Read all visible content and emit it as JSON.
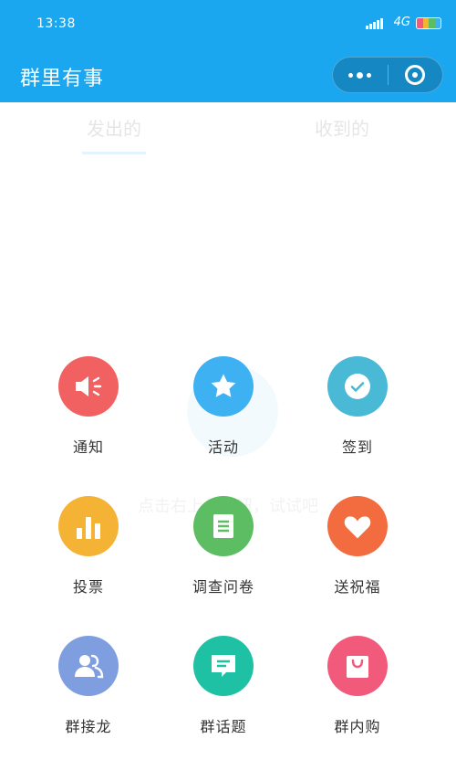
{
  "status_bar": {
    "time": "13:38",
    "network": "4G"
  },
  "header": {
    "title": "群里有事"
  },
  "tabs": [
    {
      "label": "发出的"
    },
    {
      "label": "收到的"
    }
  ],
  "hint": "点击右上角按钮，试试吧",
  "menu": [
    {
      "label": "通知",
      "icon": "megaphone-icon",
      "color": "#f26161"
    },
    {
      "label": "活动",
      "icon": "star-icon",
      "color": "#3db1f1"
    },
    {
      "label": "签到",
      "icon": "check-icon",
      "color": "#49b9d6"
    },
    {
      "label": "投票",
      "icon": "bar-chart-icon",
      "color": "#f5b335"
    },
    {
      "label": "调查问卷",
      "icon": "document-icon",
      "color": "#5cbd62"
    },
    {
      "label": "送祝福",
      "icon": "heart-icon",
      "color": "#f36c3f"
    },
    {
      "label": "群接龙",
      "icon": "users-icon",
      "color": "#7f9ee0"
    },
    {
      "label": "群话题",
      "icon": "chat-icon",
      "color": "#1fc1a5"
    },
    {
      "label": "群内购",
      "icon": "shopping-bag-icon",
      "color": "#f25a7c"
    }
  ]
}
